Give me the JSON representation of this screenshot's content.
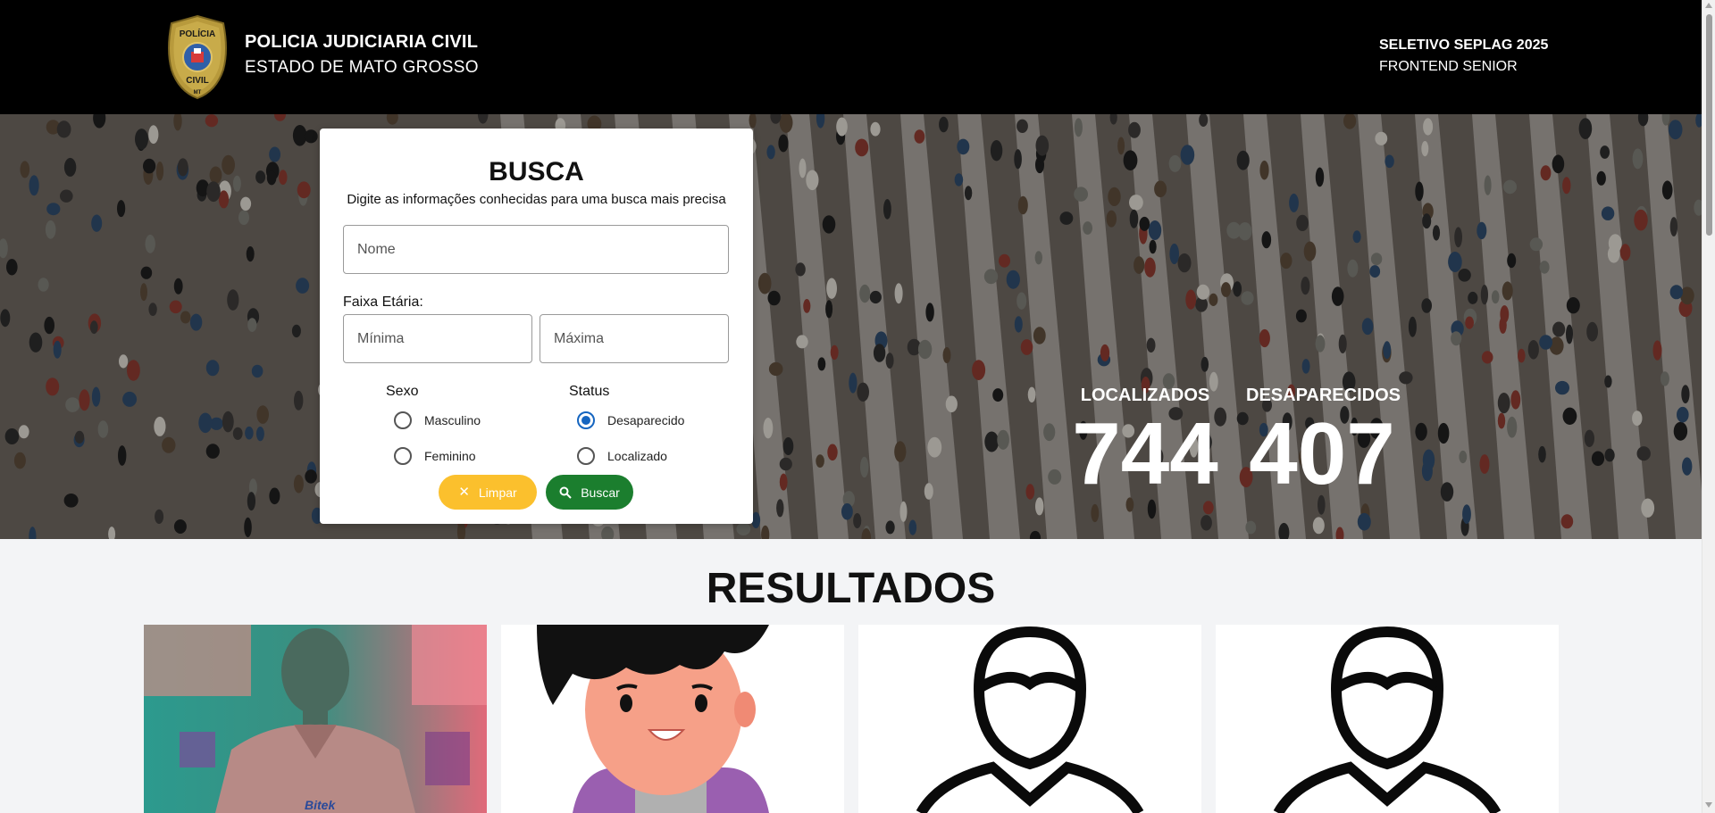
{
  "header": {
    "title": "POLICIA JUDICIARIA CIVIL",
    "subtitle": "ESTADO DE MATO GROSSO",
    "badge_text_top": "POLÍCIA",
    "badge_text_bottom": "CIVIL",
    "badge_text_mt": "MT",
    "project_title": "SELETIVO SEPLAG 2025",
    "project_subtitle": "FRONTEND SENIOR"
  },
  "search": {
    "title": "BUSCA",
    "subtitle": "Digite as informações conhecidas para uma busca mais precisa",
    "name_placeholder": "Nome",
    "age_range_label": "Faixa Etária:",
    "min_placeholder": "Mínima",
    "max_placeholder": "Máxima",
    "sex_label": "Sexo",
    "sex_options": [
      "Masculino",
      "Feminino"
    ],
    "status_label": "Status",
    "status_options": [
      "Desaparecido",
      "Localizado"
    ],
    "status_selected": "Desaparecido",
    "clear_button": "Limpar",
    "search_button": "Buscar"
  },
  "stats": {
    "found_label": "LOCALIZADOS",
    "found_count": "744",
    "missing_label": "DESAPARECIDOS",
    "missing_count": "407"
  },
  "results": {
    "title": "RESULTADOS",
    "photo_shirt_text": "Bitek"
  },
  "colors": {
    "header_bg": "#000000",
    "clear_button": "#fbc02d",
    "search_button": "#1b7e2e",
    "radio_selected": "#1565c0",
    "page_bg": "#f3f4f6"
  },
  "icons": {
    "clear": "close-icon",
    "search": "search-icon"
  }
}
